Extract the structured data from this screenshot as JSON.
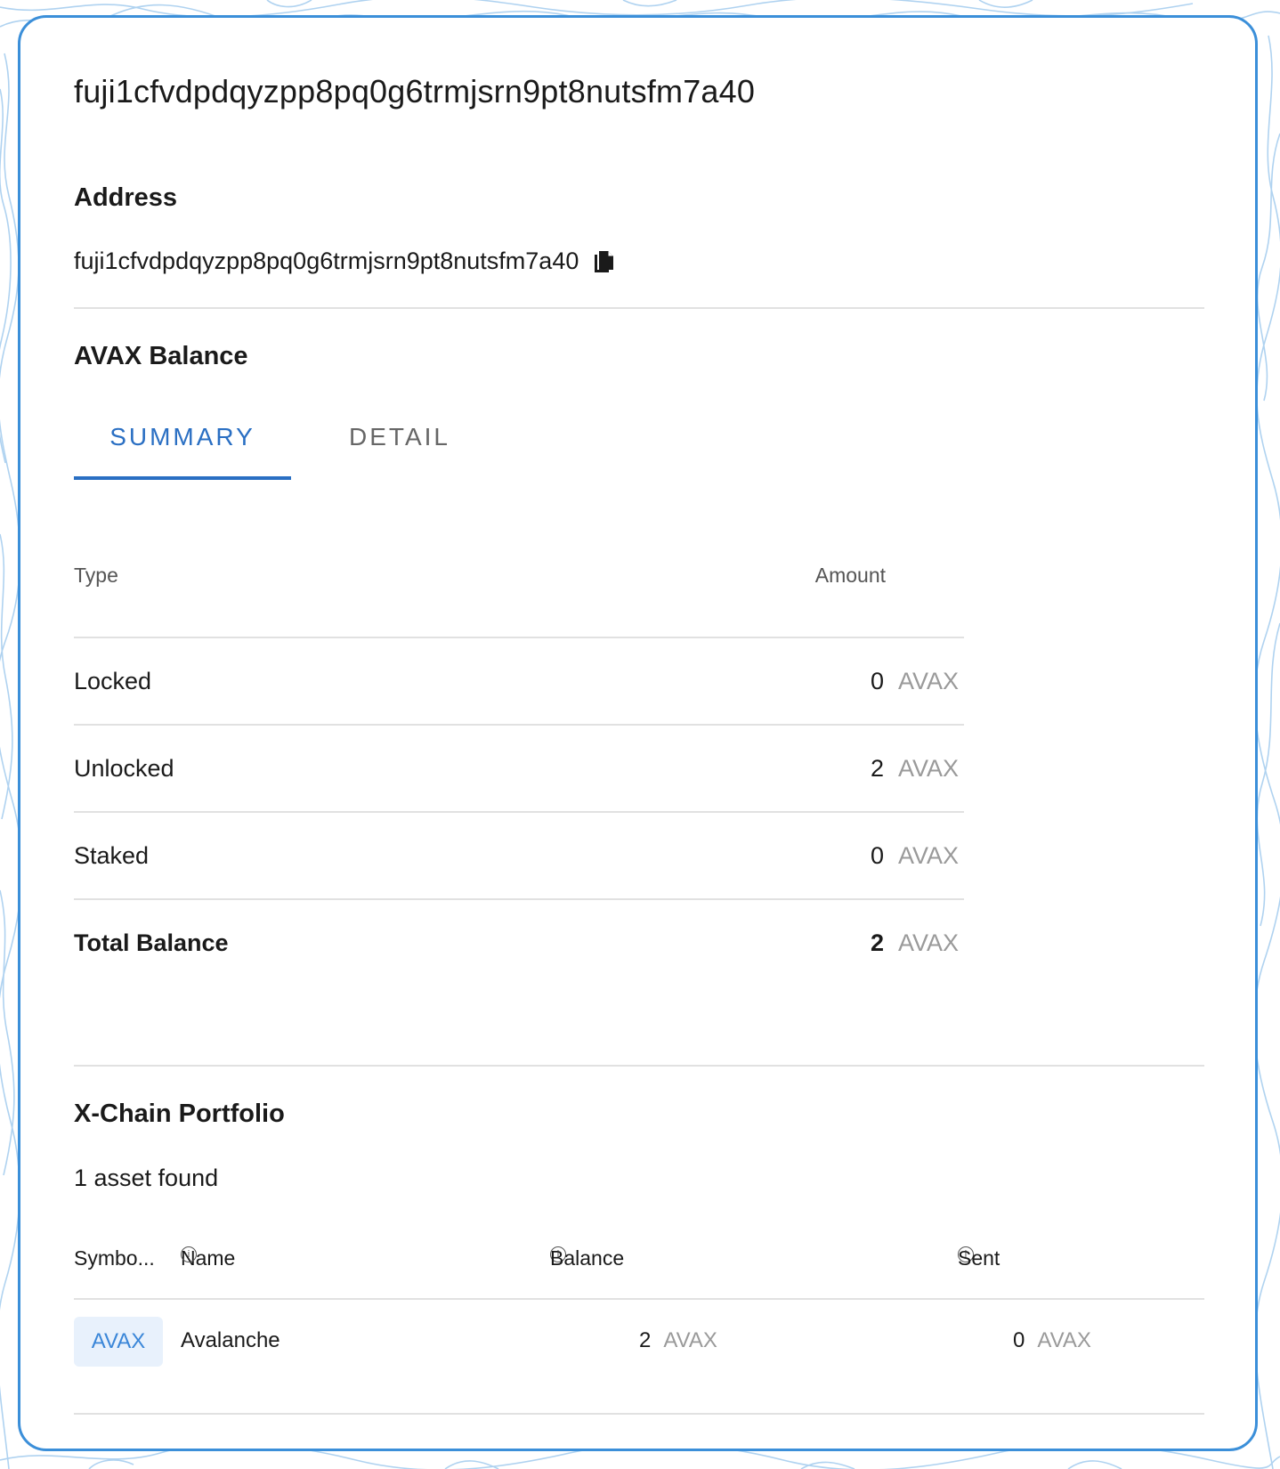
{
  "page": {
    "title": "fuji1cfvdpdqyzpp8pq0g6trmjsrn9pt8nutsfm7a40"
  },
  "address": {
    "heading": "Address",
    "value": "fuji1cfvdpdqyzpp8pq0g6trmjsrn9pt8nutsfm7a40"
  },
  "balance": {
    "heading": "AVAX Balance",
    "tabs": [
      {
        "label": "SUMMARY",
        "active": true
      },
      {
        "label": "DETAIL",
        "active": false
      }
    ],
    "columns": {
      "type": "Type",
      "amount": "Amount"
    },
    "rows": [
      {
        "type": "Locked",
        "amount": "0",
        "unit": "AVAX"
      },
      {
        "type": "Unlocked",
        "amount": "2",
        "unit": "AVAX"
      },
      {
        "type": "Staked",
        "amount": "0",
        "unit": "AVAX"
      }
    ],
    "total": {
      "label": "Total Balance",
      "amount": "2",
      "unit": "AVAX"
    }
  },
  "portfolio": {
    "heading": "X-Chain Portfolio",
    "count_text": "1 asset found",
    "columns": {
      "symbol": "Symbo...",
      "name": "Name",
      "balance": "Balance",
      "sent": "Sent"
    },
    "rows": [
      {
        "symbol": "AVAX",
        "name": "Avalanche",
        "balance": "2",
        "balance_unit": "AVAX",
        "sent": "0",
        "sent_unit": "AVAX"
      }
    ]
  },
  "colors": {
    "accent": "#2a6fc3",
    "border": "#3b8fd9",
    "badge_bg": "#e8f1fc",
    "muted": "#9a9a9a"
  }
}
